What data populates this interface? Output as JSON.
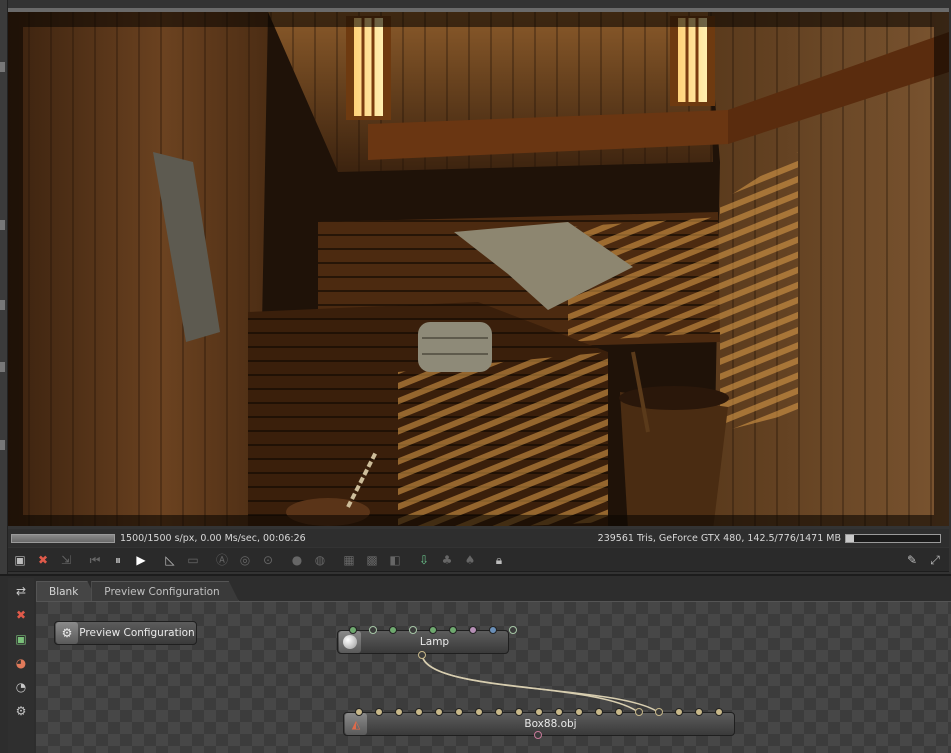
{
  "status": {
    "render_progress": 1.0,
    "samples_text": "1500/1500 s/px, 0.00 Ms/sec, 00:06:26",
    "gpu_text": "239561 Tris, GeForce GTX 480, 142.5/776/1471 MB",
    "memory_used_fraction": 0.08
  },
  "toolbar": {
    "left_icons": [
      "screenshot-icon",
      "clear-icon",
      "refocus-icon",
      "rewind-icon",
      "pause-icon",
      "play-icon",
      "measure-icon",
      "monitor-icon",
      "aperture-icon",
      "camera-target-icon",
      "lock-target-icon",
      "sphere-icon",
      "sphere-alt-icon",
      "region-icon",
      "checker-icon",
      "half-icon",
      "import-icon",
      "tree-icon",
      "tree-alt-icon",
      "lock-icon"
    ],
    "right_icons": [
      "wrench-icon",
      "fullscreen-icon"
    ]
  },
  "side_tools": [
    "node-arrange-icon",
    "clear-cache-icon",
    "image-node-icon",
    "material-node-icon",
    "texture-node-icon",
    "settings-node-icon"
  ],
  "tabs": [
    {
      "label": "Blank"
    },
    {
      "label": "Preview Configuration"
    }
  ],
  "nodes": {
    "preview_config": {
      "label": "Preview Configuration"
    },
    "lamp": {
      "label": "Lamp",
      "pin_colors": [
        "#6fa96f",
        "#3a3a3a",
        "#6fa96f",
        "#3a3a3a",
        "#6fa96f",
        "#6fa96f",
        "#b58fb5",
        "#6a8fb8",
        "#3a3a3a"
      ]
    },
    "box": {
      "label": "Box88.obj"
    }
  },
  "colors": {
    "panel": "#2d2d2d",
    "node_pin": "#c9b98a"
  }
}
